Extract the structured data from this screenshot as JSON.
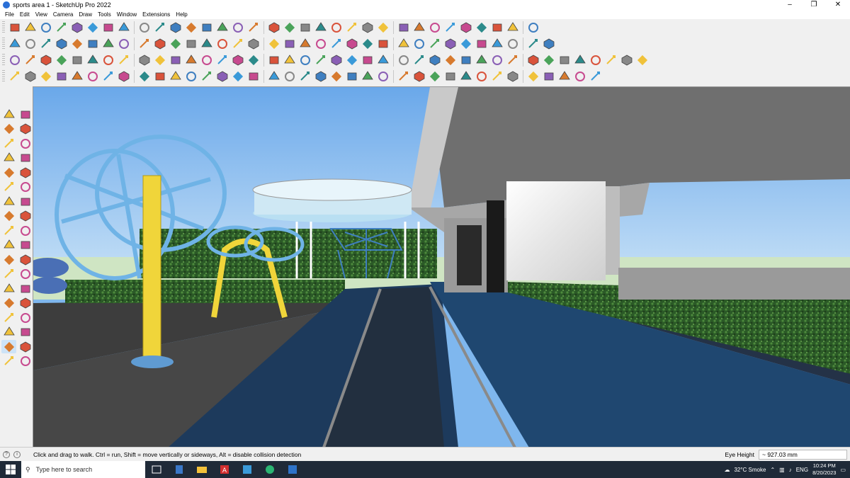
{
  "window": {
    "title": "sports area 1 - SketchUp Pro 2022",
    "minimize_glyph": "–",
    "maximize_glyph": "❐",
    "close_glyph": "✕"
  },
  "menu": [
    "File",
    "Edit",
    "View",
    "Camera",
    "Draw",
    "Tools",
    "Window",
    "Extensions",
    "Help"
  ],
  "toolbar_rows": [
    {
      "top": "row1",
      "icons": [
        "zoom-icon",
        "select-icon",
        "eraser-icon",
        "line-icon",
        "arc-icon",
        "rectangle-icon",
        "pushpull-icon",
        "followme-icon",
        "move-icon",
        "rotate-icon",
        "scale-icon",
        "tape-icon",
        "text-icon",
        "paint-icon",
        "orbit-icon",
        "pan-icon",
        "zoomwindow-icon",
        "zoomextents-icon",
        "section-icon",
        "xray-icon",
        "shadow-icon",
        "styles-icon",
        "component-icon",
        "solid-icon",
        "outer-shell-icon",
        "intersect-icon",
        "union-icon",
        "subtract-icon",
        "trim-icon",
        "split-icon",
        "undo-icon",
        "redo-icon",
        "model-info-icon"
      ]
    },
    {
      "top": "row2",
      "icons": [
        "iso-view-icon",
        "top-view-icon",
        "front-view-icon",
        "right-view-icon",
        "back-view-icon",
        "left-view-icon",
        "bottom-view-icon",
        "perspective-icon",
        "warehouse-icon",
        "extension-icon",
        "sandbox-icon",
        "flip-icon",
        "house-icon",
        "house2-icon",
        "house3-icon",
        "house4-icon",
        "fx-icon",
        "tag-icon",
        "circle-icon",
        "polygon-icon",
        "ellipse-icon",
        "hexagon-icon",
        "pentagon-icon",
        "octagon-icon",
        "shape-icon",
        "shape2-icon",
        "shape3-icon",
        "knife-icon",
        "paintbrush-icon",
        "material-icon",
        "material2-icon",
        "material3-icon",
        "material4-icon",
        "material5-icon"
      ]
    },
    {
      "top": "row3",
      "icons": [
        "box-icon",
        "cube-icon",
        "cylinder-icon",
        "cone-icon",
        "sphere-icon",
        "torus-icon",
        "prism-icon",
        "pyramid-icon",
        "wedge-icon",
        "dome-icon",
        "tube-icon",
        "helix-icon",
        "stair-icon",
        "wall-icon",
        "window-icon",
        "door-icon",
        "roof-icon",
        "beam-icon",
        "column-icon",
        "slab-icon",
        "truss-icon",
        "fence-icon",
        "railing-icon",
        "grid-icon",
        "array-icon",
        "mirror-icon",
        "offset-icon",
        "fillet-icon",
        "chamfer-icon",
        "bevel-icon",
        "loft-icon",
        "sweep-icon",
        "extrude-icon",
        "revolve-icon",
        "shell-icon",
        "thicken-icon",
        "cut-icon",
        "group-icon",
        "explode-icon",
        "center-icon"
      ]
    },
    {
      "top": "row4",
      "icons": [
        "curve-icon",
        "spline-icon",
        "bezier-icon",
        "nurbs-icon",
        "weld-icon",
        "smooth-icon",
        "subdivide-icon",
        "crease-icon",
        "knife2-icon",
        "slice-icon",
        "vertex-icon",
        "edge-icon",
        "face-icon",
        "soften-icon",
        "reverse-icon",
        "orient-icon",
        "align-icon",
        "distribute-icon",
        "snap-icon",
        "measure-icon",
        "dimension-icon",
        "label-icon",
        "angle-icon",
        "radius-icon",
        "area-icon",
        "volume-icon",
        "cloth-icon",
        "hatch-icon",
        "pattern-icon",
        "lattice-icon",
        "mesh-icon",
        "texture-icon",
        "uv-icon",
        "bake-icon",
        "render-icon",
        "light-icon",
        "camera-icon"
      ]
    }
  ],
  "status": {
    "message": "Click and drag to walk.  Ctrl = run, Shift = move vertically or sideways, Alt = disable collision detection",
    "measure_label": "Eye Height",
    "measure_value": "~ 927.03 mm"
  },
  "taskbar": {
    "search_placeholder": "Type here to search",
    "weather": "32°C  Smoke",
    "language": "ENG",
    "time": "10:24 PM",
    "date": "8/20/2023"
  },
  "colors": {
    "sky": "#7fb7ee",
    "track": "#1e3f63",
    "hedge": "#2f5a2a",
    "equipment_blue": "#6fb3e6",
    "equipment_yellow": "#f0d53a"
  }
}
